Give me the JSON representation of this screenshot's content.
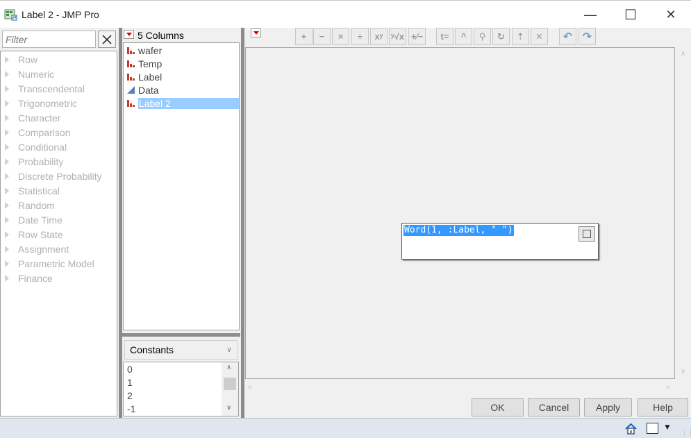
{
  "window": {
    "title": "Label 2 - JMP Pro",
    "minimize": "—",
    "maximize": "☐",
    "close": "✕"
  },
  "functions": {
    "filter_placeholder": "Filter",
    "items": [
      "Row",
      "Numeric",
      "Transcendental",
      "Trigonometric",
      "Character",
      "Comparison",
      "Conditional",
      "Probability",
      "Discrete Probability",
      "Statistical",
      "Random",
      "Date Time",
      "Row State",
      "Assignment",
      "Parametric Model",
      "Finance"
    ]
  },
  "columns": {
    "count_label": "5 Columns",
    "items": [
      {
        "label": "wafer",
        "type": "nominal"
      },
      {
        "label": "Temp",
        "type": "nominal"
      },
      {
        "label": "Label",
        "type": "nominal"
      },
      {
        "label": "Data",
        "type": "continuous"
      },
      {
        "label": "Label 2",
        "type": "nominal",
        "selected": true
      }
    ]
  },
  "constants": {
    "selected": "Constants",
    "items": [
      "0",
      "1",
      "2",
      "-1"
    ]
  },
  "formula": {
    "expression": "Word(1, :Label, \" \")"
  },
  "toolbar": {
    "buttons": [
      {
        "name": "add",
        "glyph": "+"
      },
      {
        "name": "subtract",
        "glyph": "−"
      },
      {
        "name": "multiply",
        "glyph": "×"
      },
      {
        "name": "divide",
        "glyph": "÷"
      },
      {
        "name": "power",
        "glyph": "xʸ"
      },
      {
        "name": "root",
        "glyph": "ʸ√x"
      },
      {
        "name": "change-sign",
        "glyph": "+∕−"
      },
      {
        "name": "local-variable",
        "glyph": "t="
      },
      {
        "name": "peel",
        "glyph": "^"
      },
      {
        "name": "search",
        "glyph": "⚲"
      },
      {
        "name": "refresh",
        "glyph": "↻"
      },
      {
        "name": "apply-func",
        "glyph": "⇡"
      },
      {
        "name": "delete",
        "glyph": "✕"
      },
      {
        "name": "undo",
        "glyph": "↶"
      },
      {
        "name": "redo",
        "glyph": "↷"
      }
    ]
  },
  "dialog_buttons": {
    "ok": "OK",
    "cancel": "Cancel",
    "apply": "Apply",
    "help": "Help"
  },
  "colors": {
    "selection": "#99ccff",
    "formula_highlight": "#3399ff",
    "red_triangle": "#d40000",
    "column_icon_nominal": "#c0392b",
    "column_icon_continuous": "#5b7fbf"
  }
}
